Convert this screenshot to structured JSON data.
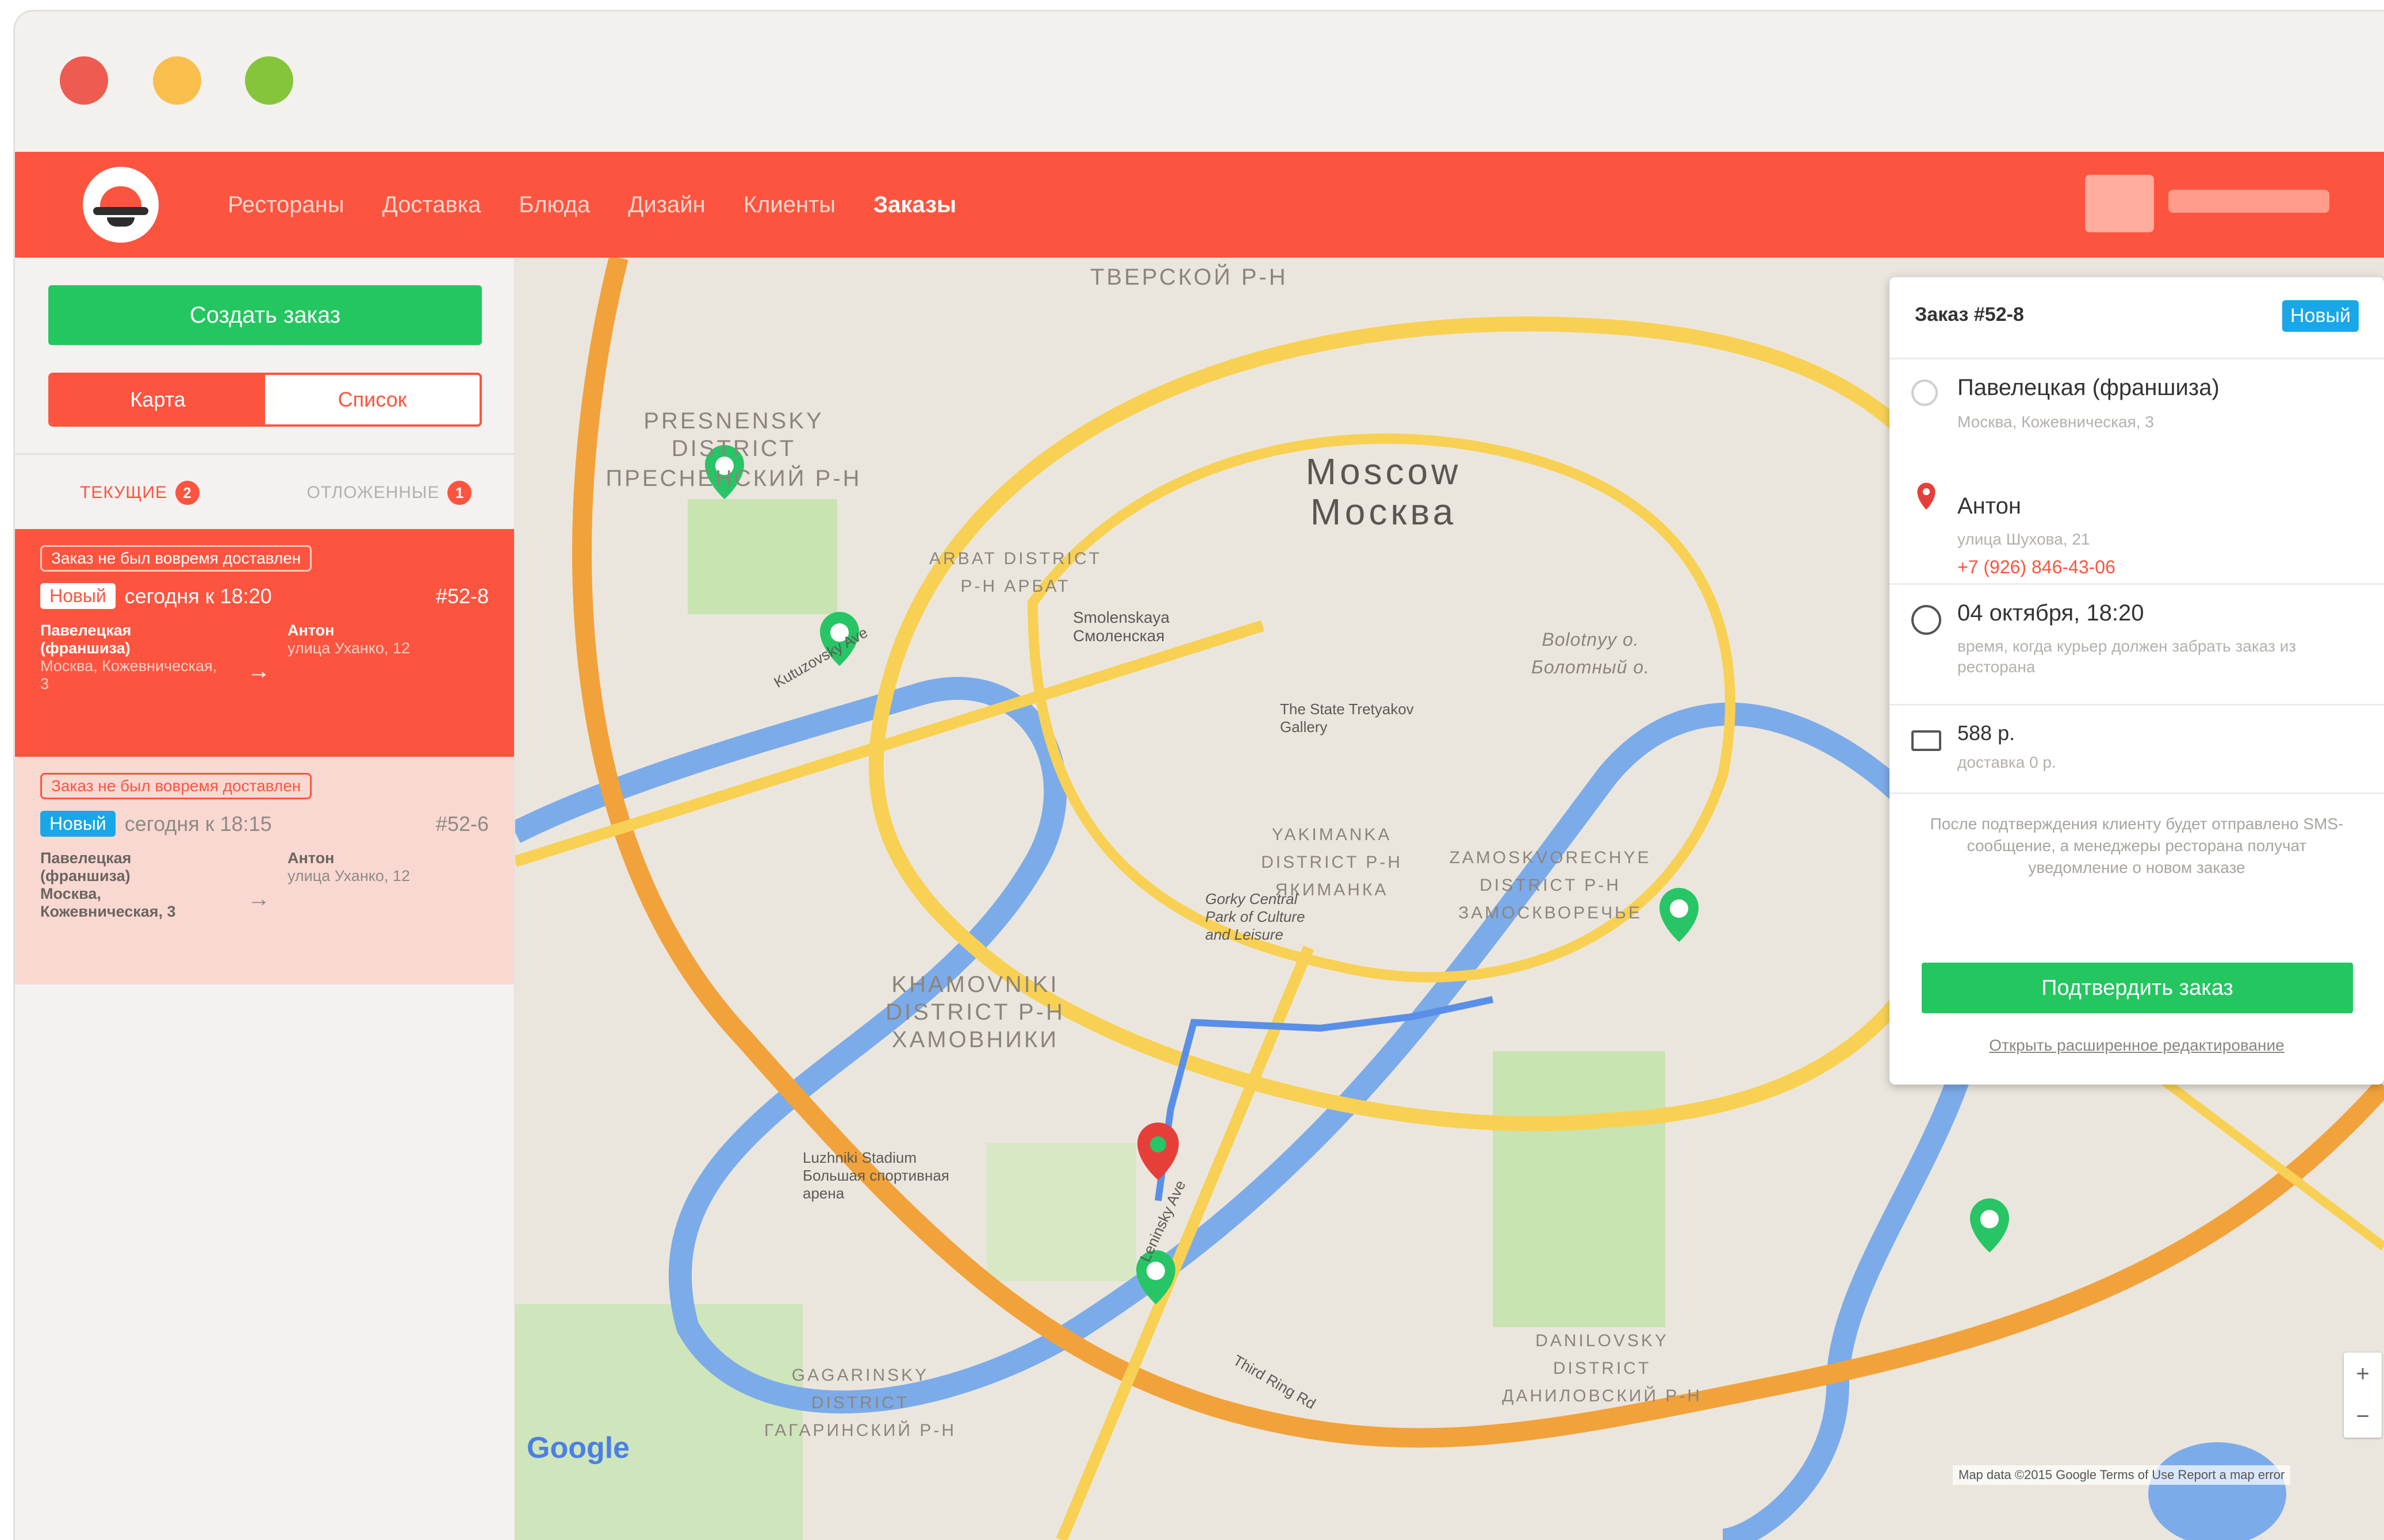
{
  "nav": {
    "items": [
      "Рестораны",
      "Доставка",
      "Блюда",
      "Дизайн",
      "Клиенты",
      "Заказы"
    ],
    "active": "Заказы"
  },
  "sidebar": {
    "create_label": "Создать заказ",
    "view_map": "Карта",
    "view_list": "Список",
    "tab_current": "ТЕКУЩИЕ",
    "tab_current_count": "2",
    "tab_deferred": "ОТЛОЖЕННЫЕ",
    "tab_deferred_count": "1",
    "orders": [
      {
        "warning": "Заказ не был вовремя доставлен",
        "status": "Новый",
        "time": "сегодня к 18:20",
        "number": "#52-8",
        "from_name": "Павелецкая (франшиза)",
        "from_address": "Москва, Кожевническая, 3",
        "to_name": "Антон",
        "to_address": "улица Уханко, 12"
      },
      {
        "warning": "Заказ не был вовремя доставлен",
        "status": "Новый",
        "time": "сегодня к 18:15",
        "number": "#52-6",
        "from_name": "Павелецкая (франшиза)",
        "from_address": "Москва, Кожевническая, 3",
        "to_name": "Антон",
        "to_address": "улица Уханко, 12"
      }
    ]
  },
  "map": {
    "labels": {
      "moscow_en": "Moscow",
      "moscow_ru": "Москва",
      "presnensky": "PRESNENSKY DISTRICT",
      "presnensky_ru": "ПРЕСНЕНСКИЙ Р-Н",
      "tverskoy": "ТВЕРСКОЙ Р-Н",
      "arbat": "ARBAT DISTRICT Р-Н АРБАТ",
      "khamovniki": "KHAMOVNIKI DISTRICT Р-Н ХАМОВНИКИ",
      "yakimanka": "YAKIMANKA DISTRICT Р-Н ЯКИМАНКА",
      "zamoskvorechye": "ZAMOSKVORECHYE DISTRICT Р-Н ЗАМОСКВОРЕЧЬЕ",
      "danilovsky": "DANILOVSKY DISTRICT ДАНИЛОВСКИЙ Р-Н",
      "gagarinsky": "GAGARINSKY DISTRICT ГАГАРИНСКИЙ Р-Н",
      "bolotnyy": "Bolotnyy o. Болотный о.",
      "smolenskaya": "Smolenskaya Смоленская",
      "luzhniki": "Luzhniki Stadium Большая спортивная арена",
      "gorky": "Gorky Central Park of Culture and Leisure",
      "tretyakov": "The State Tretyakov Gallery",
      "third_ring": "Third Ring Rd",
      "kutuzovsky": "Kutuzovsky Ave",
      "leninsky": "Leninsky Ave"
    },
    "zoom_in": "+",
    "zoom_out": "−",
    "google": "Google",
    "attribution": "Map data ©2015 Google   Terms of Use   Report a map error"
  },
  "card": {
    "title": "Заказ #52-8",
    "status": "Новый",
    "from_name": "Павелецкая (франшиза)",
    "from_address": "Москва, Кожевническая, 3",
    "to_name": "Антон",
    "to_address": "улица Шухова, 21",
    "to_phone": "+7 (926) 846-43-06",
    "date": "04 октября, 18:20",
    "date_note": "время, когда курьер должен забрать заказ из ресторана",
    "price": "588 р.",
    "delivery": "доставка 0 р.",
    "note": "После подтверждения клиенту будет отправлено SMS-сообщение, а менеджеры ресторана получат уведомление о новом заказе",
    "confirm_label": "Подтвердить заказ",
    "advanced_label": "Открыть расширенное редактирование"
  },
  "colors": {
    "brand": "#fd543f",
    "accept": "#24c660",
    "status_new": "#18a7e9"
  }
}
